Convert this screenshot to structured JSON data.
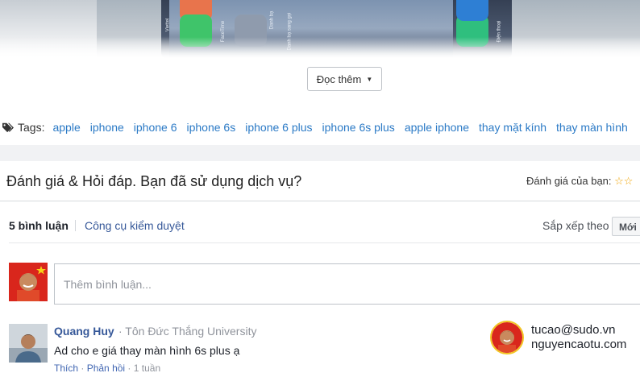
{
  "hero": {
    "side_texts": [
      "Viettel",
      "FaceTime",
      "Danh bạ",
      "Danh bạ sang gọi",
      "Điện thoại"
    ]
  },
  "read_more": {
    "label": "Đọc thêm",
    "caret": "▼"
  },
  "tags": {
    "label": "Tags:",
    "items": [
      "apple",
      "iphone",
      "iphone 6",
      "iphone 6s",
      "iphone 6 plus",
      "iphone 6s plus",
      "apple iphone",
      "thay mặt kính",
      "thay màn hình"
    ]
  },
  "review": {
    "title": "Đánh giá & Hỏi đáp. Bạn đã sử dụng dịch vụ?",
    "rating_label": "Đánh giá của bạn:",
    "stars": "☆☆"
  },
  "comments_bar": {
    "count": "5 bình luận",
    "moderation": "Công cụ kiểm duyệt",
    "sort_label": "Sắp xếp theo",
    "sort_value": "Mới"
  },
  "composer": {
    "placeholder": "Thêm bình luận..."
  },
  "comment": {
    "author": "Quang Huy",
    "school": "· Tôn Đức Thắng University",
    "text": "Ad cho e giá thay màn hình 6s plus ạ",
    "like": "Thích",
    "reply": "Phản hồi",
    "dot": "·",
    "time": "· 1 tuần"
  },
  "contact": {
    "email": "tucao@sudo.vn",
    "site": "nguyencaotu.com"
  },
  "colors": {
    "link": "#2b7ac6",
    "fb_blue": "#365899",
    "star": "#f0a300"
  }
}
